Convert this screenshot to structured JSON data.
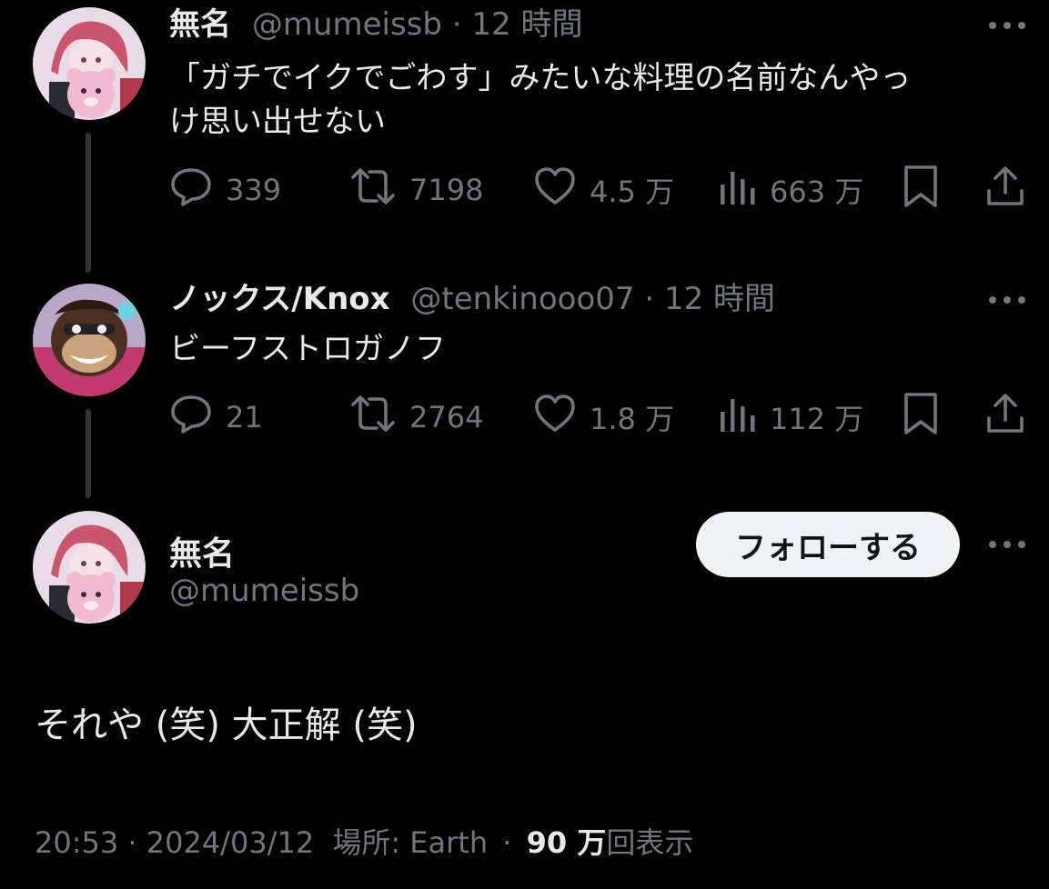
{
  "thread": [
    {
      "display_name": "無名",
      "handle": "@mumeissb",
      "separator": "·",
      "time": "12 時間",
      "text_lines": [
        "「ガチでイクでごわす」みたいな料理の名前なんやっ",
        "け思い出せない"
      ],
      "replies": "339",
      "reposts": "7198",
      "likes": "4.5 万",
      "views": "663 万"
    },
    {
      "display_name": "ノックス/Knox",
      "handle": "@tenkinooo07",
      "separator": "·",
      "time": "12 時間",
      "text_lines": [
        "ビーフストロガノフ"
      ],
      "replies": "21",
      "reposts": "2764",
      "likes": "1.8 万",
      "views": "112 万"
    }
  ],
  "main_post": {
    "display_name": "無名",
    "handle": "@mumeissb",
    "follow_label": "フォローする",
    "text": "それや (笑) 大正解 (笑)",
    "timestamp": "20:53 · 2024/03/12",
    "location_label": "場所: Earth",
    "separator": "·",
    "views_count": "90 万",
    "views_label": "回表示"
  },
  "colors": {
    "background": "#000000",
    "text_primary": "#e7e9ea",
    "text_secondary": "#71767b",
    "thread_line": "#333639",
    "follow_button_bg": "#eff3f4"
  },
  "icons": [
    "reply-icon",
    "repost-icon",
    "like-icon",
    "views-icon",
    "bookmark-icon",
    "share-icon",
    "more-icon"
  ]
}
